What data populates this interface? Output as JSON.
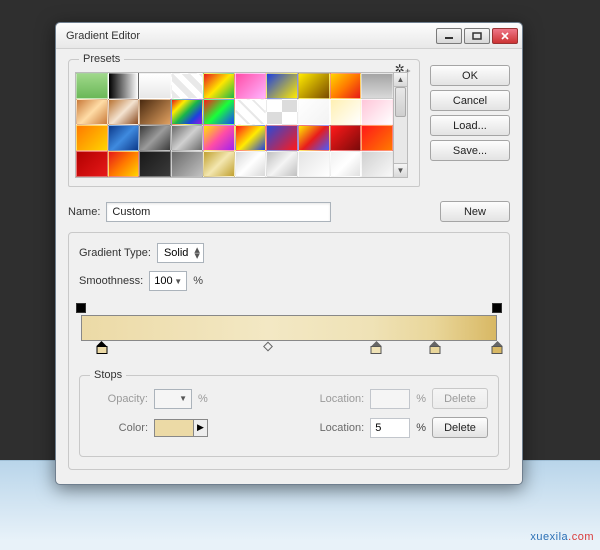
{
  "window": {
    "title": "Gradient Editor"
  },
  "presets": {
    "label": "Presets",
    "rows": [
      [
        "linear-gradient(#9fd88a,#6bb858)",
        "linear-gradient(90deg,#000,#fff)",
        "linear-gradient(#fff,#e8e8e8)",
        "repeating-linear-gradient(45deg,#e9e9e9 0 6px,#fff 6px 12px)",
        "linear-gradient(135deg,#e81c1c,#ffe600,#19b54a)",
        "linear-gradient(135deg,#ff4da6,#ffb3ff)",
        "linear-gradient(135deg,#1d3fe0,#ffeb00)",
        "linear-gradient(135deg,#ffea00,#7a4a00)",
        "linear-gradient(135deg,#ffd400,#ff7a00,#e61919)",
        "linear-gradient(#a5a5a5,#d9d9d9)"
      ],
      [
        "linear-gradient(135deg,#c97a3a,#ffdca6,#c97a3a)",
        "linear-gradient(135deg,#b87333,#f4e3d0,#8a4a1f)",
        "linear-gradient(135deg,#4a2a10,#e0a060)",
        "linear-gradient(135deg,#e61919,#ffeb00,#19b54a,#1d3fe0,#9b19e0)",
        "linear-gradient(135deg,#ff1919,#19ff3a,#1940ff)",
        "repeating-linear-gradient(45deg,#fff 0 8px,#e8e8e8 8px 10px)",
        "repeating-conic-gradient(#dcdcdc 0 25%,#fff 0 50%)",
        "linear-gradient(135deg,#fff,#f3f3f3)",
        "linear-gradient(135deg,#fff0b3,#fff)",
        "linear-gradient(135deg,#ffc6d9,#fff)"
      ],
      [
        "linear-gradient(135deg,#ff7a00,#ffd400)",
        "linear-gradient(135deg,#0d3a8a,#3f8adf,#0d3a8a)",
        "linear-gradient(135deg,#3a3a3a,#9b9b9b,#3a3a3a)",
        "linear-gradient(135deg,#6a6a6a,#d0d0d0,#6a6a6a)",
        "linear-gradient(135deg,#ffe600,#ff4da6,#a020f0)",
        "linear-gradient(135deg,#ff1919,#ffeb00,#1d3fe0)",
        "linear-gradient(135deg,#2a4ad8,#ff1919)",
        "linear-gradient(135deg,#ffeb00,#e81c1c,#485cff)",
        "linear-gradient(135deg,#ff1919,#7a0a0a)",
        "linear-gradient(135deg,#ff1919,#ff7a00)"
      ],
      [
        "linear-gradient(135deg,#b30000,#e61919)",
        "linear-gradient(135deg,#e61919,#ff7a00,#ffd400)",
        "linear-gradient(135deg,#191919,#3a3a3a)",
        "linear-gradient(135deg,#6a6a6a,#c0c0c0)",
        "linear-gradient(135deg,#c0a030,#f4e7b0,#c0a030)",
        "linear-gradient(135deg,#d8d8d8,#fff,#d8d8d8)",
        "linear-gradient(135deg,#c0c0c0,#f4f4f4,#c0c0c0)",
        "linear-gradient(135deg,#e4e4e4,#fff)",
        "linear-gradient(135deg,#f0f0f0,#fff,#e0e0e0)",
        "linear-gradient(135deg,#d0d0d0,#f8f8f8)"
      ]
    ]
  },
  "buttons": {
    "ok": "OK",
    "cancel": "Cancel",
    "load": "Load...",
    "save": "Save...",
    "new": "New",
    "delete": "Delete"
  },
  "name": {
    "label": "Name:",
    "value": "Custom"
  },
  "gradient": {
    "type_label": "Gradient Type:",
    "type_value": "Solid",
    "smoothness_label": "Smoothness:",
    "smoothness_value": "100",
    "percent": "%",
    "bar_css": "linear-gradient(90deg,#ecdaa6 0%, #f3e8c4 45%, #efe2b6 70%, #e9d69a 85%, #d8b864 100%)",
    "opacity_stops": [
      0,
      100
    ],
    "midpoints": [
      45
    ],
    "color_stops": [
      {
        "pos": 5,
        "color": "#ecdaa6",
        "sel": true
      },
      {
        "pos": 71,
        "color": "#efe2b6",
        "sel": false
      },
      {
        "pos": 85,
        "color": "#e9d69a",
        "sel": false
      },
      {
        "pos": 100,
        "color": "#d8b864",
        "sel": false
      }
    ]
  },
  "stops": {
    "label": "Stops",
    "opacity_label": "Opacity:",
    "location_label": "Location:",
    "color_label": "Color:",
    "opacity_value": "",
    "opacity_location": "",
    "color_value": "#ecdaa6",
    "color_location": "5"
  },
  "watermark": {
    "a": "xuexila",
    "b": ".com"
  }
}
